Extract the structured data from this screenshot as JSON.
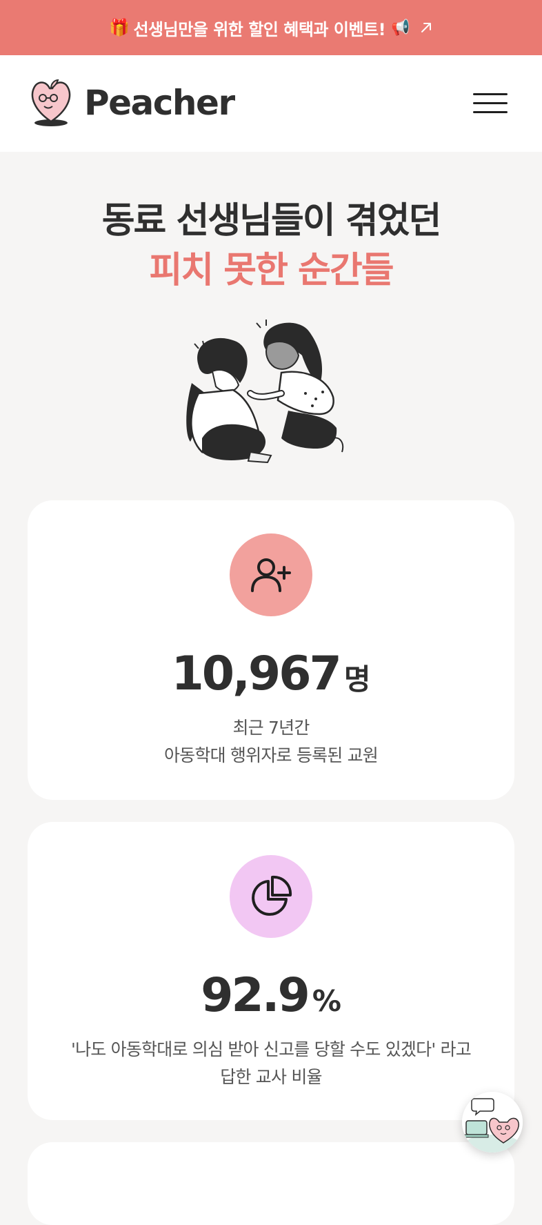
{
  "banner": {
    "gift_icon": "🎁",
    "text": "선생님만을 위한 할인 혜택과 이벤트!",
    "megaphone_icon": "📢",
    "arrow_icon": "external-arrow-icon",
    "color": "#ea7a72"
  },
  "header": {
    "logo_text": "Peacher",
    "menu_icon": "hamburger-icon"
  },
  "hero": {
    "line1": "동료 선생님들이 겪었던",
    "line2": "피치 못한 순간들",
    "accent_color": "#e97770"
  },
  "stats": [
    {
      "icon": "user-plus-icon",
      "icon_bg": "#f2a19d",
      "value": "10,967",
      "unit": "명",
      "desc_line1": "최근 7년간",
      "desc_line2": "아동학대 행위자로 등록된 교원"
    },
    {
      "icon": "pie-chart-icon",
      "icon_bg": "#f2c7f3",
      "value": "92.9",
      "unit": "%",
      "desc_line1": "'나도 아동학대로 의심 받아 신고를 당할 수도 있겠다' 라고",
      "desc_line2": "답한 교사 비율"
    }
  ],
  "fab": {
    "icon": "chat-assistant-icon"
  }
}
